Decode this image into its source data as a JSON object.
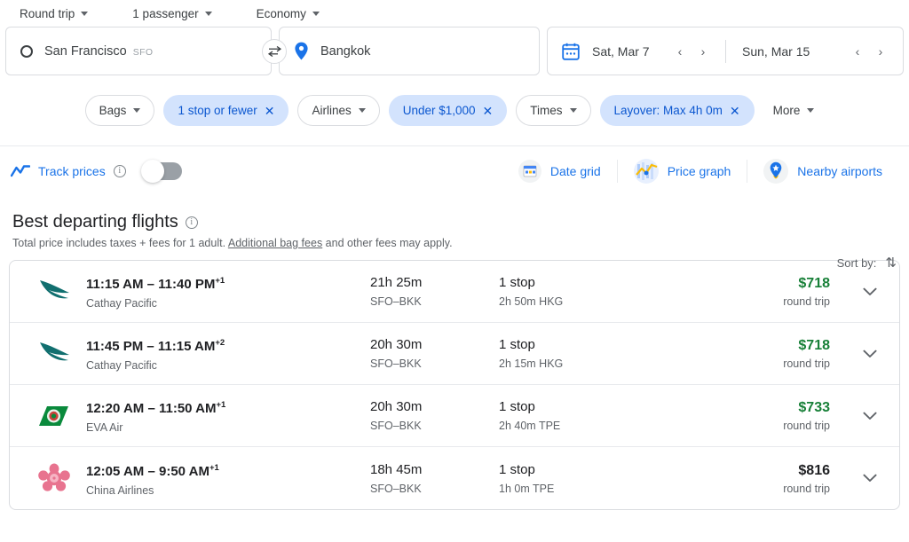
{
  "options": [
    {
      "label": "Round trip",
      "name": "trip-type"
    },
    {
      "label": "1 passenger",
      "name": "passengers"
    },
    {
      "label": "Economy",
      "name": "cabin-class"
    }
  ],
  "search": {
    "origin": {
      "city": "San Francisco",
      "code": "SFO"
    },
    "destination": {
      "city": "Bangkok",
      "code": ""
    },
    "depart_date": "Sat, Mar 7",
    "return_date": "Sun, Mar 15",
    "swap_icon": "swap-icon",
    "prev_icon": "‹",
    "next_icon": "›"
  },
  "filters": [
    {
      "label": "Bags",
      "active": false,
      "has_caret": true,
      "has_x": false
    },
    {
      "label": "1 stop or fewer",
      "active": true,
      "has_caret": false,
      "has_x": true
    },
    {
      "label": "Airlines",
      "active": false,
      "has_caret": true,
      "has_x": false
    },
    {
      "label": "Under $1,000",
      "active": true,
      "has_caret": false,
      "has_x": true
    },
    {
      "label": "Times",
      "active": false,
      "has_caret": true,
      "has_x": false
    },
    {
      "label": "Layover: Max 4h 0m",
      "active": true,
      "has_caret": false,
      "has_x": true
    },
    {
      "label": "More",
      "active": false,
      "has_caret": true,
      "has_x": false
    }
  ],
  "tools": {
    "track_prices_label": "Track prices",
    "track_prices_enabled": false,
    "items": [
      {
        "label": "Date grid",
        "icon": "date-grid-icon"
      },
      {
        "label": "Price graph",
        "icon": "price-graph-icon"
      },
      {
        "label": "Nearby airports",
        "icon": "nearby-airports-icon"
      }
    ]
  },
  "results": {
    "title": "Best departing flights",
    "subtitle_before": "Total price includes taxes + fees for 1 adult. ",
    "subtitle_link": "Additional bag fees",
    "subtitle_after": " and other fees may apply.",
    "sort_label": "Sort by:",
    "flights": [
      {
        "airline": "Cathay Pacific",
        "logo": "cathay-pacific-logo",
        "times": "11:15 AM – 11:40 PM",
        "day_offset": "+1",
        "duration": "21h 25m",
        "route": "SFO–BKK",
        "stops": "1 stop",
        "layover": "2h 50m HKG",
        "price": "$718",
        "price_note": "round trip",
        "price_highlight": true
      },
      {
        "airline": "Cathay Pacific",
        "logo": "cathay-pacific-logo",
        "times": "11:45 PM – 11:15 AM",
        "day_offset": "+2",
        "duration": "20h 30m",
        "route": "SFO–BKK",
        "stops": "1 stop",
        "layover": "2h 15m HKG",
        "price": "$718",
        "price_note": "round trip",
        "price_highlight": true
      },
      {
        "airline": "EVA Air",
        "logo": "eva-air-logo",
        "times": "12:20 AM – 11:50 AM",
        "day_offset": "+1",
        "duration": "20h 30m",
        "route": "SFO–BKK",
        "stops": "1 stop",
        "layover": "2h 40m TPE",
        "price": "$733",
        "price_note": "round trip",
        "price_highlight": true
      },
      {
        "airline": "China Airlines",
        "logo": "china-airlines-logo",
        "times": "12:05 AM – 9:50 AM",
        "day_offset": "+1",
        "duration": "18h 45m",
        "route": "SFO–BKK",
        "stops": "1 stop",
        "layover": "1h 0m TPE",
        "price": "$816",
        "price_note": "round trip",
        "price_highlight": false
      }
    ]
  },
  "colors": {
    "accent_blue": "#1a73e8",
    "chip_active_bg": "#d3e3fd",
    "chip_active_text": "#0b57d0",
    "price_green": "#188038",
    "text_primary": "#202124",
    "text_secondary": "#5f6368"
  }
}
